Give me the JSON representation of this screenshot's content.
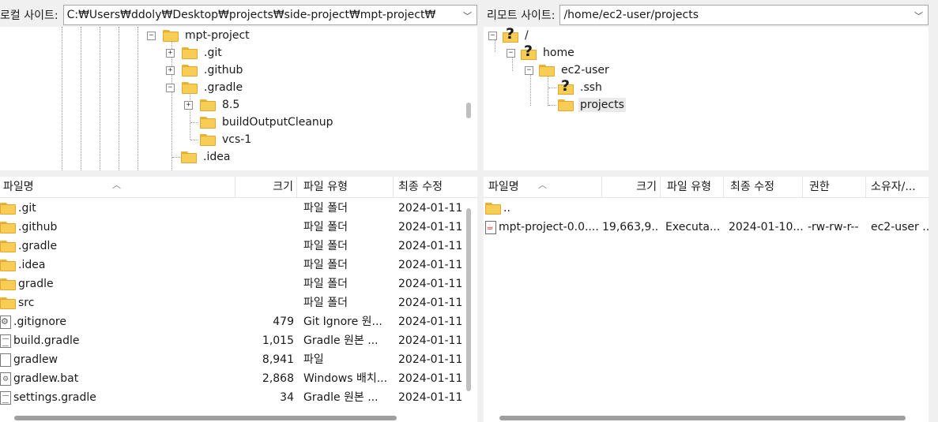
{
  "local": {
    "label": "로컬 사이트:",
    "path": "C:₩Users₩ddoly₩Desktop₩projects₩side-project₩mpt-project₩",
    "tree": [
      {
        "name": "mpt-project",
        "expander": "⊟"
      },
      {
        "name": ".git",
        "expander": "⊞"
      },
      {
        "name": ".github",
        "expander": "⊞"
      },
      {
        "name": ".gradle",
        "expander": "⊟"
      },
      {
        "name": "8.5",
        "expander": "⊞"
      },
      {
        "name": "buildOutputCleanup",
        "expander": ""
      },
      {
        "name": "vcs-1",
        "expander": ""
      },
      {
        "name": ".idea",
        "expander": ""
      }
    ],
    "columns": {
      "name": "파일명",
      "size": "크기",
      "type": "파일 유형",
      "modified": "최종 수정"
    },
    "files": [
      {
        "name": ".git",
        "size": "",
        "type": "파일 폴더",
        "modified": "2024-01-11",
        "icon": "folder-icon"
      },
      {
        "name": ".github",
        "size": "",
        "type": "파일 폴더",
        "modified": "2024-01-11",
        "icon": "folder-icon"
      },
      {
        "name": ".gradle",
        "size": "",
        "type": "파일 폴더",
        "modified": "2024-01-11",
        "icon": "folder-icon"
      },
      {
        "name": ".idea",
        "size": "",
        "type": "파일 폴더",
        "modified": "2024-01-11",
        "icon": "folder-icon"
      },
      {
        "name": "gradle",
        "size": "",
        "type": "파일 폴더",
        "modified": "2024-01-11",
        "icon": "folder-icon"
      },
      {
        "name": "src",
        "size": "",
        "type": "파일 폴더",
        "modified": "2024-01-11",
        "icon": "folder-icon"
      },
      {
        "name": ".gitignore",
        "size": "479",
        "type": "Git Ignore 원...",
        "modified": "2024-01-11",
        "icon": "gitignore-file-icon"
      },
      {
        "name": "build.gradle",
        "size": "1,015",
        "type": "Gradle 원본 ...",
        "modified": "2024-01-11",
        "icon": "text-file-icon"
      },
      {
        "name": "gradlew",
        "size": "8,941",
        "type": "파일",
        "modified": "2024-01-11",
        "icon": "blank-file-icon"
      },
      {
        "name": "gradlew.bat",
        "size": "2,868",
        "type": "Windows 배치...",
        "modified": "2024-01-11",
        "icon": "batch-file-icon"
      },
      {
        "name": "settings.gradle",
        "size": "34",
        "type": "Gradle 원본 ...",
        "modified": "2024-01-11",
        "icon": "text-file-icon"
      }
    ]
  },
  "remote": {
    "label": "리모트 사이트:",
    "path": "/home/ec2-user/projects",
    "tree": [
      {
        "name": "/",
        "expander": "⊟"
      },
      {
        "name": "home",
        "expander": "⊟"
      },
      {
        "name": "ec2-user",
        "expander": "⊟"
      },
      {
        "name": ".ssh",
        "expander": ""
      },
      {
        "name": "projects",
        "expander": ""
      }
    ],
    "columns": {
      "name": "파일명",
      "size": "크기",
      "type": "파일 유형",
      "modified": "최종 수정",
      "perm": "권한",
      "owner": "소유자/..."
    },
    "files": [
      {
        "name": "..",
        "size": "",
        "type": "",
        "modified": "",
        "perm": "",
        "owner": "",
        "icon": "folder-icon"
      },
      {
        "name": "mpt-project-0.0....",
        "size": "19,663,9...",
        "type": "Executa...",
        "modified": "2024-01-10...",
        "perm": "-rw-rw-r--",
        "owner": "ec2-user ...",
        "icon": "java-file-icon"
      }
    ]
  }
}
